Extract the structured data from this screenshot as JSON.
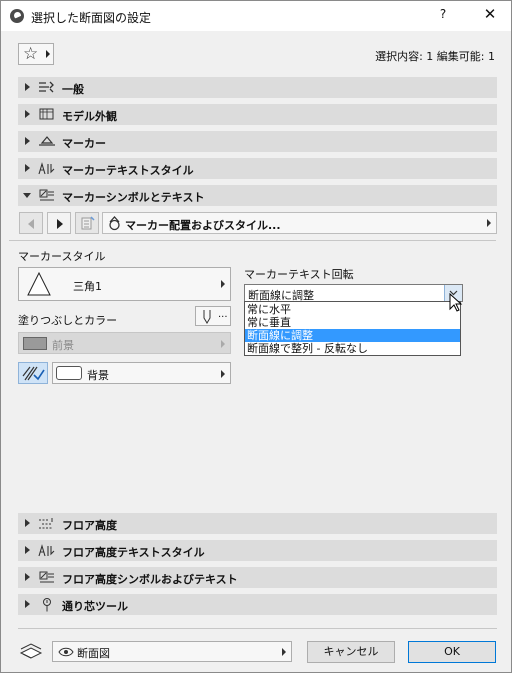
{
  "window": {
    "title": "選択した断面図の設定",
    "help": "?",
    "close": "✕"
  },
  "toolbar": {
    "favorites_icon": "star-icon",
    "selection_info": "選択内容: 1 編集可能: 1"
  },
  "panels_top": [
    {
      "label": "一般",
      "icon": "general-settings-icon"
    },
    {
      "label": "モデル外観",
      "icon": "model-appearance-icon"
    },
    {
      "label": "マーカー",
      "icon": "marker-icon"
    },
    {
      "label": "マーカーテキストスタイル",
      "icon": "text-style-icon"
    },
    {
      "label": "マーカーシンボルとテキスト",
      "icon": "symbol-text-icon",
      "expanded": true
    }
  ],
  "nav": {
    "page_label": "マーカー配置およびスタイル..."
  },
  "marker_style": {
    "label": "マーカースタイル",
    "value": "三角1"
  },
  "fill": {
    "label": "塗りつぶしとカラー",
    "fill_value": "前景",
    "background_value": "背景"
  },
  "rotation": {
    "label": "マーカーテキスト回転",
    "selected": "断面線に調整",
    "options": [
      "常に水平",
      "常に垂直",
      "断面線に調整",
      "断面線で整列 - 反転なし"
    ],
    "highlighted_index": 2
  },
  "panels_bottom": [
    {
      "label": "フロア高度",
      "icon": "floor-level-icon"
    },
    {
      "label": "フロア高度テキストスタイル",
      "icon": "text-style-icon"
    },
    {
      "label": "フロア高度シンボルおよびテキスト",
      "icon": "symbol-text-icon"
    },
    {
      "label": "通り芯ツール",
      "icon": "grid-tool-icon"
    }
  ],
  "footer": {
    "layer_value": "断面図",
    "cancel": "キャンセル",
    "ok": "OK"
  }
}
